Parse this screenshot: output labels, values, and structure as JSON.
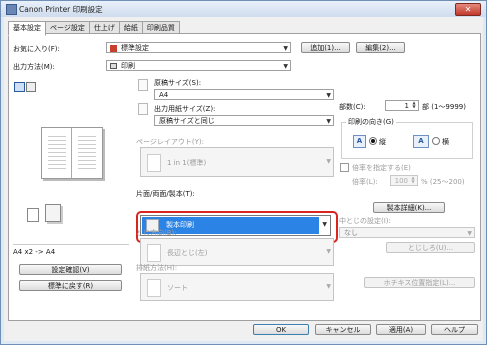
{
  "window": {
    "title": "Canon Printer 印刷設定",
    "close_label": "✕"
  },
  "tabs": [
    "基本設定",
    "ページ設定",
    "仕上げ",
    "給紙",
    "印刷品質"
  ],
  "favorites": {
    "label": "お気に入り(F):",
    "value": "標準設定",
    "add_label": "追加(1)...",
    "edit_label": "編集(2)..."
  },
  "output": {
    "label": "出力方法(M):",
    "value": "印刷"
  },
  "original_size": {
    "label": "原稿サイズ(S):",
    "value": "A4"
  },
  "output_paper": {
    "label": "出力用紙サイズ(Z):",
    "value": "原稿サイズと同じ"
  },
  "page_layout": {
    "label": "ページレイアウト(Y):",
    "value": "1 in 1(標準)"
  },
  "print_style": {
    "label": "片面/両面/製本(T):",
    "value": "製本印刷"
  },
  "binding": {
    "label": "とじ方向(B):",
    "value": "長辺とじ(左)"
  },
  "output_order": {
    "label": "排紙方法(H):",
    "value": "ソート"
  },
  "preview": {
    "caption": "A4 x2 -> A4",
    "settings_btn": "設定確認(V)",
    "defaults_btn": "標準に戻す(R)"
  },
  "copies": {
    "label": "部数(C):",
    "value": "1",
    "unit": "部 (1〜9999)"
  },
  "orientation": {
    "label": "印刷の向き(G)",
    "portrait": "縦",
    "landscape": "横",
    "selected": "portrait"
  },
  "scale": {
    "check_label": "倍率を指定する(E)",
    "label": "倍率(L):",
    "value": "100",
    "unit": "% (25〜200)"
  },
  "booklet_detail_btn": "製本詳細(K)...",
  "gutter": {
    "label": "中とじの設定(I):",
    "value": "なし",
    "margin_btn": "とじしろ(U)...",
    "staple_btn": "ホチキス位置指定(L)..."
  },
  "footer": {
    "ok": "OK",
    "cancel": "キャンセル",
    "apply": "適用(A)",
    "help": "ヘルプ"
  }
}
